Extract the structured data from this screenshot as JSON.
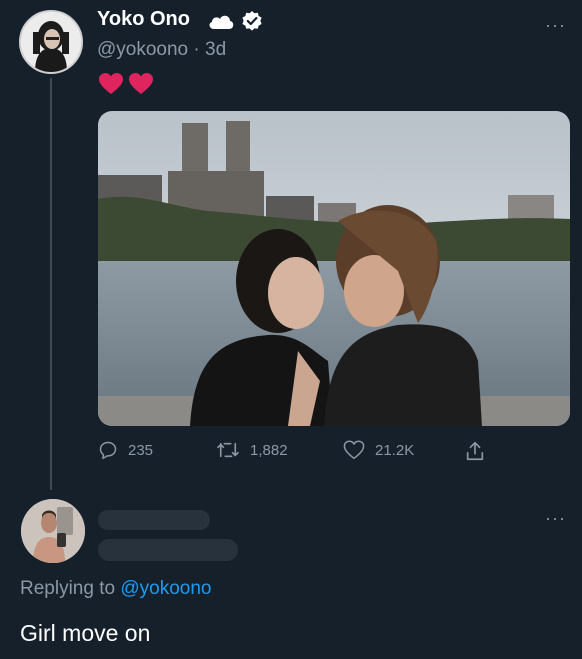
{
  "tweet": {
    "display_name": "Yoko Ono",
    "handle": "@yokoono",
    "separator": " · ",
    "timestamp": "3d",
    "emoji": [
      "❤️",
      "❤️"
    ],
    "more_label": "···",
    "stats": {
      "replies": "235",
      "retweets": "1,882",
      "likes": "21.2K"
    }
  },
  "reply": {
    "replying_prefix": "Replying to ",
    "mention": "@yokoono",
    "text": "Girl move on",
    "more_label": "···"
  },
  "icons": [
    "cloud-icon",
    "verified-icon",
    "more-icon",
    "heart-icon",
    "reply-icon",
    "retweet-icon",
    "like-icon",
    "share-icon"
  ],
  "colors": {
    "background": "#15202b",
    "secondary_text": "#8b98a5",
    "link": "#1d9bf0",
    "heart": "#e0245e"
  }
}
